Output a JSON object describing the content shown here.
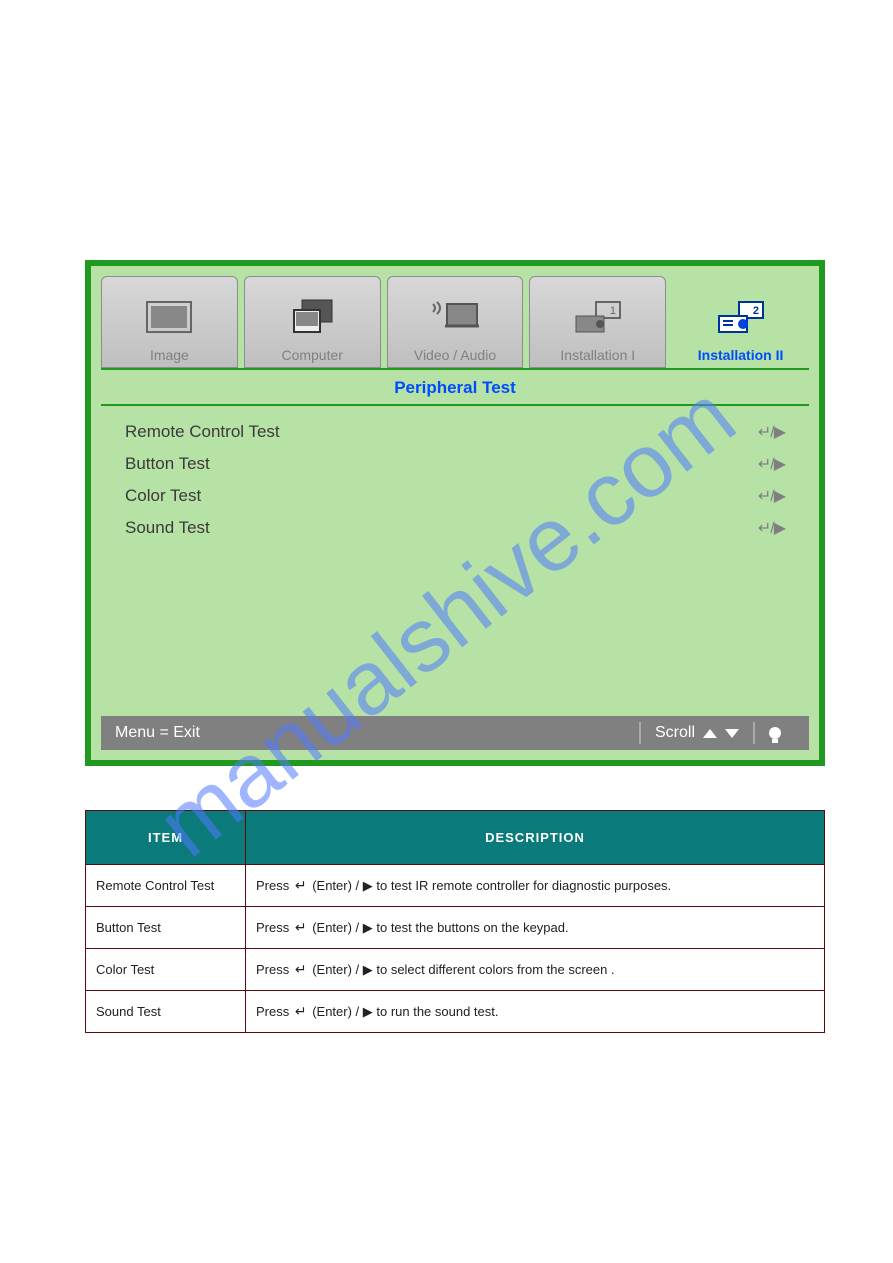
{
  "watermark": "manualshive.com",
  "osd": {
    "tabs": [
      {
        "label": "Image",
        "icon": "monitor-icon"
      },
      {
        "label": "Computer",
        "icon": "computer-icon"
      },
      {
        "label": "Video / Audio",
        "icon": "video-audio-icon"
      },
      {
        "label": "Installation I",
        "icon": "projector1-icon"
      },
      {
        "label": "Installation II",
        "icon": "projector2-icon"
      }
    ],
    "title": "Peripheral Test",
    "items": [
      {
        "label": "Remote Control Test",
        "hint": "↵/▶"
      },
      {
        "label": "Button Test",
        "hint": "↵/▶"
      },
      {
        "label": "Color Test",
        "hint": "↵/▶"
      },
      {
        "label": "Sound Test",
        "hint": "↵/▶"
      }
    ],
    "footer": {
      "left": "Menu = Exit",
      "scroll": "Scroll"
    }
  },
  "table": {
    "headers": [
      "ITEM",
      "DESCRIPTION"
    ],
    "rows": [
      {
        "item": "Remote Control Test",
        "desc_pre": "Press ",
        "desc_post": " (Enter) / ▶ to test IR remote controller for diagnostic purposes."
      },
      {
        "item": "Button Test",
        "desc_pre": "Press ",
        "desc_post": " (Enter) / ▶ to test the buttons on the keypad."
      },
      {
        "item": "Color Test",
        "desc_pre": "Press ",
        "desc_post": " (Enter) / ▶ to select different colors from the screen ."
      },
      {
        "item": "Sound Test",
        "desc_pre": "Press ",
        "desc_post": " (Enter) / ▶ to run the sound test."
      }
    ]
  }
}
